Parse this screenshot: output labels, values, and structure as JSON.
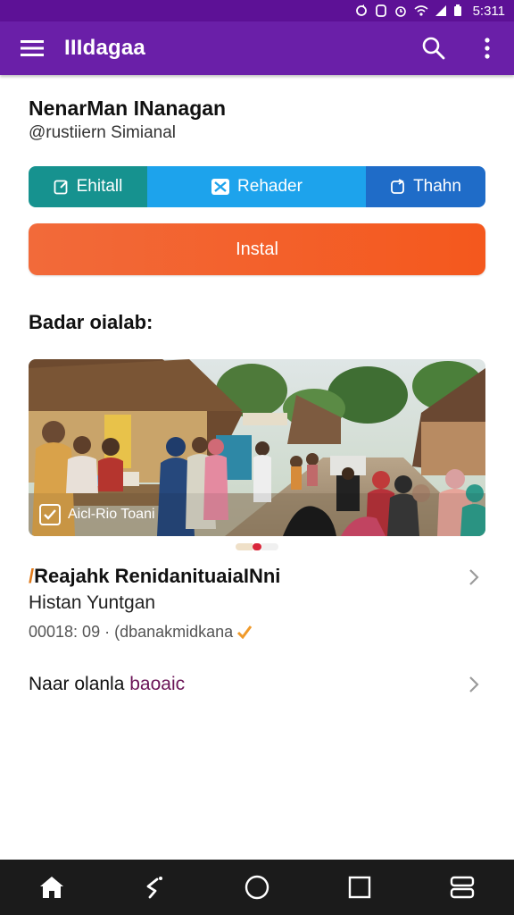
{
  "status_bar": {
    "time": "5:311"
  },
  "app_bar": {
    "title": "IIIdagaa"
  },
  "profile": {
    "name": "NenarMan INanagan",
    "handle": "@rustiiern Simianal"
  },
  "segments": [
    {
      "label": "Ehitall",
      "icon": "edit-icon"
    },
    {
      "label": "Rehader",
      "icon": "close-box-icon"
    },
    {
      "label": "Thahn",
      "icon": "refresh-icon"
    }
  ],
  "install_button": {
    "label": "Instal"
  },
  "section": {
    "title": "Badar oialab:"
  },
  "photo": {
    "caption": "Aicl-Rio Toani"
  },
  "list": [
    {
      "title": "Reajahk RenidanituaiaINni",
      "subtitle": "Histan Yuntgan",
      "meta": "00018: 09 · (dbanakmidkana"
    },
    {
      "prefix": "Naar olanla",
      "accent": "baoaic"
    }
  ],
  "colors": {
    "app_bar": "#6a1fa8",
    "status_bar": "#5d1196",
    "install": "#f4581d",
    "seg_a": "#16928f",
    "seg_b": "#1da3ec",
    "seg_c": "#1f6cc8"
  }
}
